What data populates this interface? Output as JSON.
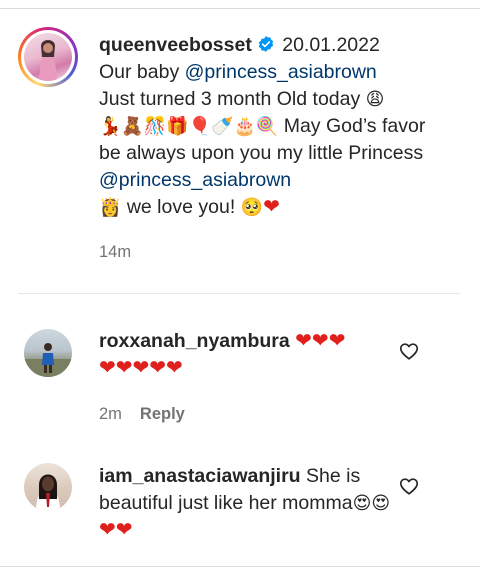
{
  "post": {
    "username": "queenveebosset",
    "date": "20.01.2022",
    "text_1": "Our baby ",
    "mention_1": "@princess_asiabrown",
    "text_2": "Just turned 3 month Old today ",
    "emoji_1": "😩",
    "emoji_row": "💃🧸🎊🎁🎈🍼🎂🍭",
    "text_3": " May God’s favor be always upon you my little Princess ",
    "mention_2": "@princess_asiabrown",
    "emoji_2": "👸",
    "text_4": " we love you! ",
    "emoji_3": "🥺",
    "heart": "❤",
    "time": "14m"
  },
  "comments": [
    {
      "username": "roxxanah_nyambura",
      "hearts_line1": "❤❤❤",
      "hearts_line2": "❤❤❤❤❤",
      "time": "2m",
      "reply_label": "Reply"
    },
    {
      "username": "iam_anastaciawanjiru",
      "text": "She is beautiful just like her momma",
      "emojis": "😍😍",
      "hearts": "❤❤"
    }
  ],
  "icons": {
    "verified": "verified-badge-icon",
    "like": "heart-outline-icon"
  },
  "colors": {
    "mention": "#00376b",
    "verified": "#0095f6",
    "secondary_text": "#737373",
    "heart": "#e0201d"
  }
}
